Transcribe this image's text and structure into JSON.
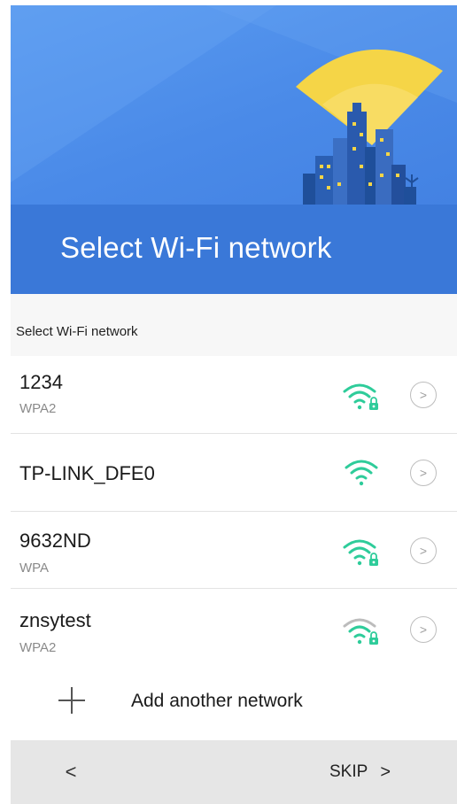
{
  "hero": {
    "title": "Select Wi-Fi network"
  },
  "section": {
    "header": "Select Wi-Fi network"
  },
  "networks": [
    {
      "name": "1234",
      "security": "WPA2",
      "icon": "wifi-lock-icon",
      "signal_color": "#2ecc9a"
    },
    {
      "name": "TP-LINK_DFE0",
      "security": "",
      "icon": "wifi-icon",
      "signal_color": "#2ecc9a"
    },
    {
      "name": "9632ND",
      "security": "WPA",
      "icon": "wifi-lock-icon",
      "signal_color": "#2ecc9a"
    },
    {
      "name": "znsytest",
      "security": "WPA2",
      "icon": "wifi-lock-icon",
      "signal_color": "#2ecc9a"
    }
  ],
  "add_network": {
    "label": "Add another network",
    "icon": "plus-icon"
  },
  "footer": {
    "back_glyph": "<",
    "skip_label": "SKIP",
    "skip_glyph": ">"
  },
  "colors": {
    "hero_blue": "#4a8ae8",
    "accent_green": "#2ecc9a",
    "beam_yellow": "#f5d547"
  }
}
